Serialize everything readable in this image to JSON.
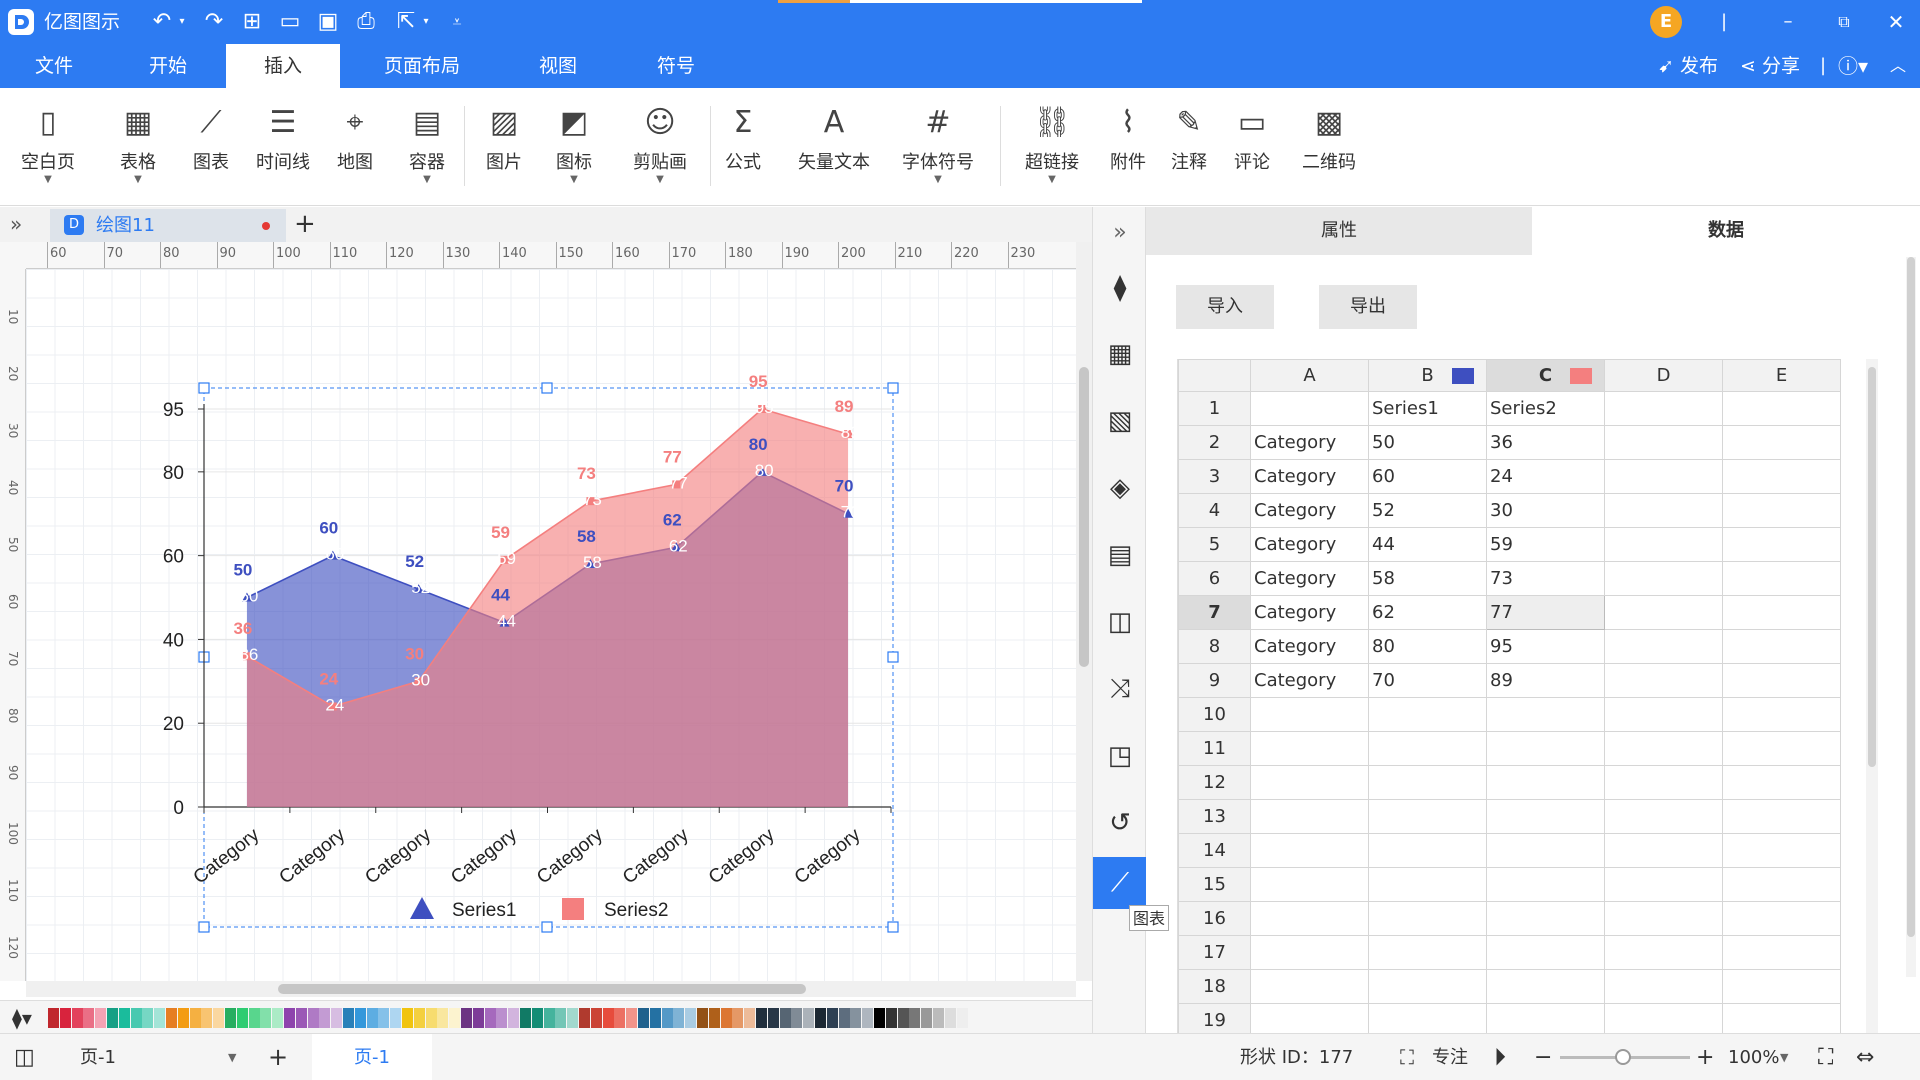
{
  "app": {
    "title": "亿图图示",
    "publish": "发布",
    "share": "分享",
    "avatar_letter": "E"
  },
  "menu": [
    "文件",
    "开始",
    "插入",
    "页面布局",
    "视图",
    "符号"
  ],
  "menu_active": 2,
  "ribbon": [
    {
      "icon": "blank-page-icon",
      "label": "空白页",
      "dropdown": true
    },
    {
      "icon": "table-icon",
      "label": "表格",
      "dropdown": true
    },
    {
      "icon": "chart-icon",
      "label": "图表",
      "dropdown": false
    },
    {
      "icon": "timeline-icon",
      "label": "时间线",
      "dropdown": false
    },
    {
      "icon": "map-icon",
      "label": "地图",
      "dropdown": false
    },
    {
      "icon": "container-icon",
      "label": "容器",
      "dropdown": true
    },
    {
      "icon": "picture-icon",
      "label": "图片",
      "dropdown": false
    },
    {
      "icon": "icon-icon",
      "label": "图标",
      "dropdown": true
    },
    {
      "icon": "clipart-icon",
      "label": "剪贴画",
      "dropdown": true
    },
    {
      "icon": "formula-icon",
      "label": "公式",
      "dropdown": false
    },
    {
      "icon": "vector-text-icon",
      "label": "矢量文本",
      "dropdown": false
    },
    {
      "icon": "font-symbol-icon",
      "label": "字体符号",
      "dropdown": true
    },
    {
      "icon": "hyperlink-icon",
      "label": "超链接",
      "dropdown": true
    },
    {
      "icon": "attachment-icon",
      "label": "附件",
      "dropdown": false
    },
    {
      "icon": "note-icon",
      "label": "注释",
      "dropdown": false
    },
    {
      "icon": "comment-icon",
      "label": "评论",
      "dropdown": false
    },
    {
      "icon": "qrcode-icon",
      "label": "二维码",
      "dropdown": false
    }
  ],
  "doc_tab": {
    "name": "绘图11"
  },
  "ruler": {
    "top": [
      "60",
      "70",
      "80",
      "90",
      "100",
      "110",
      "120",
      "130",
      "140",
      "150",
      "160",
      "170",
      "180",
      "190",
      "200",
      "210",
      "220",
      "230"
    ],
    "left": [
      "10",
      "20",
      "30",
      "40",
      "50",
      "60",
      "70",
      "80",
      "90",
      "100",
      "110",
      "120"
    ]
  },
  "chart_data": {
    "type": "area",
    "categories": [
      "Category",
      "Category",
      "Category",
      "Category",
      "Category",
      "Category",
      "Category",
      "Category"
    ],
    "series": [
      {
        "name": "Series1",
        "values": [
          50,
          60,
          52,
          44,
          58,
          62,
          80,
          70
        ],
        "color": "#3e4fc0",
        "marker": "triangle"
      },
      {
        "name": "Series2",
        "values": [
          36,
          24,
          30,
          59,
          73,
          77,
          95,
          89
        ],
        "color": "#f47f7f",
        "marker": "square"
      }
    ],
    "y_ticks": [
      0,
      20,
      40,
      60,
      80,
      95
    ],
    "ylim": [
      0,
      95
    ],
    "legend": "bottom",
    "grid": true
  },
  "side_tooltip": "图表",
  "panel": {
    "tabs": [
      "属性",
      "数据"
    ],
    "active_tab": 1,
    "import": "导入",
    "export": "导出",
    "columns": [
      "A",
      "B",
      "C",
      "D",
      "E"
    ],
    "column_colors": {
      "B": "#3e4fc0",
      "C": "#f47f7f"
    },
    "rows": [
      [
        "",
        "Series1",
        "Series2",
        "",
        ""
      ],
      [
        "Category",
        "50",
        "36",
        "",
        ""
      ],
      [
        "Category",
        "60",
        "24",
        "",
        ""
      ],
      [
        "Category",
        "52",
        "30",
        "",
        ""
      ],
      [
        "Category",
        "44",
        "59",
        "",
        ""
      ],
      [
        "Category",
        "58",
        "73",
        "",
        ""
      ],
      [
        "Category",
        "62",
        "77",
        "",
        ""
      ],
      [
        "Category",
        "80",
        "95",
        "",
        ""
      ],
      [
        "Category",
        "70",
        "89",
        "",
        ""
      ],
      [
        "",
        "",
        "",
        "",
        ""
      ],
      [
        "",
        "",
        "",
        "",
        ""
      ],
      [
        "",
        "",
        "",
        "",
        ""
      ],
      [
        "",
        "",
        "",
        "",
        ""
      ],
      [
        "",
        "",
        "",
        "",
        ""
      ],
      [
        "",
        "",
        "",
        "",
        ""
      ],
      [
        "",
        "",
        "",
        "",
        ""
      ],
      [
        "",
        "",
        "",
        "",
        ""
      ],
      [
        "",
        "",
        "",
        "",
        ""
      ],
      [
        "",
        "",
        "",
        "",
        ""
      ]
    ],
    "selected_row": 7,
    "selected_col": "C"
  },
  "status": {
    "page_select": "页-1",
    "page_tab": "页-1",
    "shape_id": "形状 ID：177",
    "focus": "专注",
    "zoom": "100%",
    "zoom_level": 1.0
  },
  "palette_colors": [
    "#c0272d",
    "#d8233d",
    "#e3425c",
    "#ea6f86",
    "#f4a3b4",
    "#16a085",
    "#1abc9c",
    "#48c9b0",
    "#76d7c4",
    "#a3e4d7",
    "#e67e22",
    "#f39c12",
    "#f5b041",
    "#f8c471",
    "#fad7a0",
    "#27ae60",
    "#2ecc71",
    "#58d68d",
    "#82e0aa",
    "#abebc6",
    "#8e44ad",
    "#9b59b6",
    "#af7ac5",
    "#c39bd3",
    "#d7bde2",
    "#2980b9",
    "#3498db",
    "#5dade2",
    "#85c1e9",
    "#aed6f1",
    "#f1c40f",
    "#f4d03f",
    "#f7dc6f",
    "#f9e79f",
    "#fcf3cf",
    "#6c3483",
    "#7d3c98",
    "#a569bd",
    "#bb8fce",
    "#d2b4de",
    "#117a65",
    "#138d75",
    "#45b39d",
    "#73c6b6",
    "#a2d9ce",
    "#b03a2e",
    "#cb4335",
    "#e74c3c",
    "#ec7063",
    "#f1948a",
    "#1f618d",
    "#2471a3",
    "#5499c7",
    "#7fb3d5",
    "#a9cce3",
    "#935116",
    "#af601a",
    "#dc7633",
    "#e59866",
    "#edbb99",
    "#212f3d",
    "#283747",
    "#566573",
    "#808b96",
    "#abb2b9",
    "#1c2833",
    "#2e4053",
    "#5d6d7e",
    "#85929e",
    "#aeb6bf",
    "#000000",
    "#333333",
    "#555555",
    "#777777",
    "#999999",
    "#bbbbbb",
    "#dddddd",
    "#eeeeee"
  ]
}
